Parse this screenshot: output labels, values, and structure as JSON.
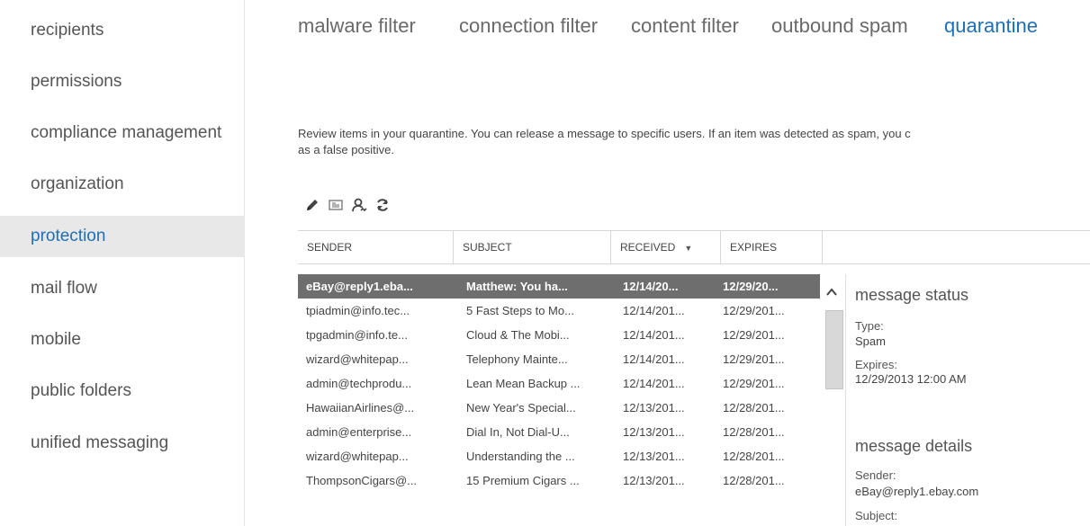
{
  "nav": {
    "items": [
      {
        "label": "recipients"
      },
      {
        "label": "permissions"
      },
      {
        "label": "compliance management"
      },
      {
        "label": "organization"
      },
      {
        "label": "protection"
      },
      {
        "label": "mail flow"
      },
      {
        "label": "mobile"
      },
      {
        "label": "public folders"
      },
      {
        "label": "unified messaging"
      }
    ],
    "active": "protection"
  },
  "tabs": [
    {
      "label": "malware filter"
    },
    {
      "label": "connection filter"
    },
    {
      "label": "content filter"
    },
    {
      "label": "outbound spam"
    },
    {
      "label": "quarantine"
    }
  ],
  "active_tab": "quarantine",
  "description": {
    "line1": "Review items in your quarantine. You can release a message to specific users. If an item was detected as spam, you c",
    "line2": "as a false positive."
  },
  "toolbar": {
    "icons": [
      "edit-icon",
      "release-message-icon",
      "report-false-positive-icon",
      "refresh-icon"
    ]
  },
  "table": {
    "columns": [
      {
        "label": "SENDER"
      },
      {
        "label": "SUBJECT"
      },
      {
        "label": "RECEIVED"
      },
      {
        "label": "EXPIRES"
      }
    ],
    "sort_column": "RECEIVED",
    "sort_direction": "descending",
    "rows": [
      {
        "sender": "eBay@reply1.eba...",
        "subject": "Matthew: You ha...",
        "received": "12/14/20...",
        "expires": "12/29/20...",
        "selected": true
      },
      {
        "sender": "tpiadmin@info.tec...",
        "subject": "5 Fast Steps to Mo...",
        "received": "12/14/201...",
        "expires": "12/29/201...",
        "selected": false
      },
      {
        "sender": "tpgadmin@info.te...",
        "subject": "Cloud & The Mobi...",
        "received": "12/14/201...",
        "expires": "12/29/201...",
        "selected": false
      },
      {
        "sender": "wizard@whitepap...",
        "subject": "Telephony Mainte...",
        "received": "12/14/201...",
        "expires": "12/29/201...",
        "selected": false
      },
      {
        "sender": "admin@techprodu...",
        "subject": "Lean Mean Backup ...",
        "received": "12/14/201...",
        "expires": "12/29/201...",
        "selected": false
      },
      {
        "sender": "HawaiianAirlines@...",
        "subject": "New Year's Special...",
        "received": "12/13/201...",
        "expires": "12/28/201...",
        "selected": false
      },
      {
        "sender": "admin@enterprise...",
        "subject": "Dial In, Not Dial-U...",
        "received": "12/13/201...",
        "expires": "12/28/201...",
        "selected": false
      },
      {
        "sender": "wizard@whitepap...",
        "subject": "Understanding the ...",
        "received": "12/13/201...",
        "expires": "12/28/201...",
        "selected": false
      },
      {
        "sender": "ThompsonCigars@...",
        "subject": "15 Premium Cigars ...",
        "received": "12/13/201...",
        "expires": "12/28/201...",
        "selected": false
      }
    ]
  },
  "details": {
    "status_heading": "message status",
    "type_label": "Type:",
    "type_value": "Spam",
    "expires_label": "Expires:",
    "expires_value": "12/29/2013 12:00 AM",
    "details_heading": "message details",
    "sender_label": "Sender:",
    "sender_value": "eBay@reply1.ebay.com",
    "subject_label": "Subject:"
  },
  "colors": {
    "accent": "#1e6fb4",
    "selected_row": "#6e6e6e",
    "nav_active_bg": "#e8e8e8"
  }
}
